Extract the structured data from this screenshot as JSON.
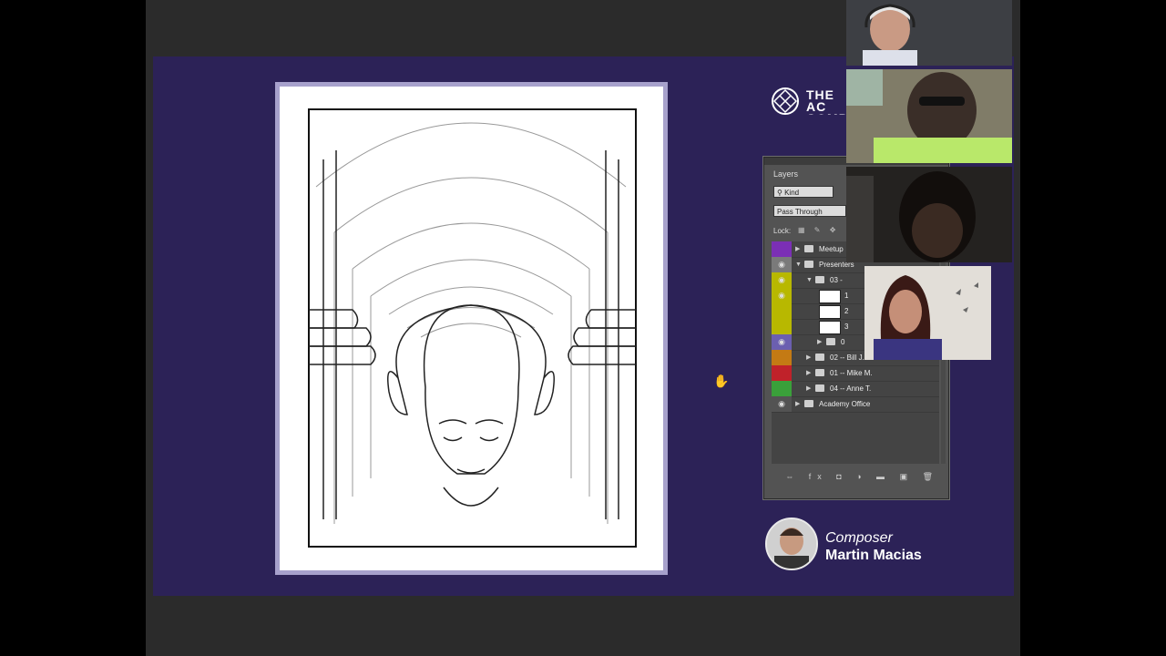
{
  "logo": {
    "text": "THE AC\nCOMP",
    "icon": "academy-logo-icon"
  },
  "layers_panel": {
    "tab_label": "Layers",
    "kind_label": "Kind",
    "blend_mode": "Pass Through",
    "lock_label": "Lock:",
    "rows": [
      {
        "name": "Meetup",
        "color": "#7b2fb5",
        "eye": false,
        "depth": 0,
        "type": "folder",
        "expanded": false
      },
      {
        "name": "Presenters",
        "color": "#7a7a7a",
        "eye": true,
        "depth": 0,
        "type": "folder",
        "expanded": true
      },
      {
        "name": "03 -",
        "color": "#b8b800",
        "eye": true,
        "depth": 1,
        "type": "folder",
        "expanded": true
      },
      {
        "name": "1",
        "color": "#b8b800",
        "eye": true,
        "depth": 2,
        "type": "layer"
      },
      {
        "name": "2",
        "color": "#b8b800",
        "eye": false,
        "depth": 2,
        "type": "layer"
      },
      {
        "name": "3",
        "color": "#b8b800",
        "eye": false,
        "depth": 2,
        "type": "layer"
      },
      {
        "name": "0",
        "color": "#6b5fb0",
        "eye": true,
        "depth": 2,
        "type": "folder",
        "expanded": false
      },
      {
        "name": "02 -- Bill J.",
        "color": "#c47a14",
        "eye": false,
        "depth": 1,
        "type": "folder",
        "expanded": false
      },
      {
        "name": "01 -- Mike M.",
        "color": "#c0222a",
        "eye": false,
        "depth": 1,
        "type": "folder",
        "expanded": false
      },
      {
        "name": "04 -- Anne T.",
        "color": "#3aa03a",
        "eye": false,
        "depth": 1,
        "type": "folder",
        "expanded": false
      },
      {
        "name": "Academy Office",
        "color": "#535353",
        "eye": true,
        "depth": 0,
        "type": "folder",
        "expanded": false
      }
    ],
    "footer_icons": "⇔ fx ◘ ◑ ▬ ▣ 🗑"
  },
  "composer": {
    "role": "Composer",
    "name": "Martin Macias"
  },
  "video_tiles": [
    "participant-1",
    "participant-2",
    "participant-3",
    "participant-4"
  ]
}
